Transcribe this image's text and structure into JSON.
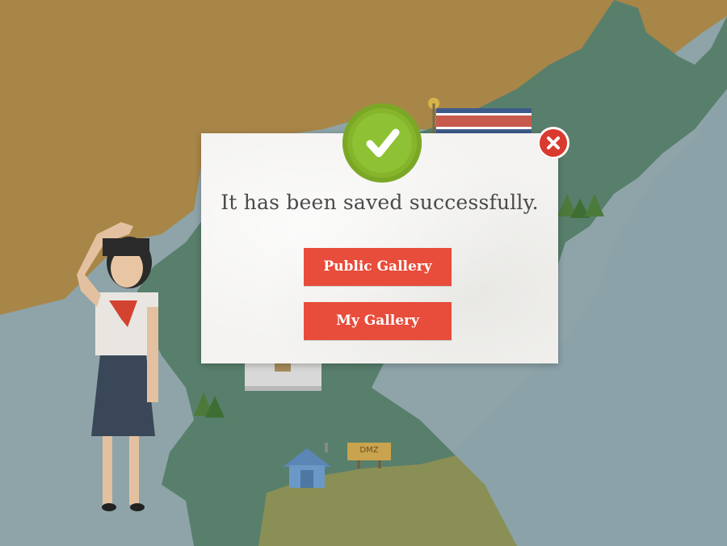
{
  "dialog": {
    "message": "It has been saved successfully.",
    "buttons": {
      "public_gallery": "Public Gallery",
      "my_gallery": "My Gallery"
    }
  },
  "map": {
    "signpost_label": "DMZ"
  },
  "icons": {
    "success": "check-icon",
    "close": "close-icon"
  },
  "colors": {
    "accent_red": "#e84c3a",
    "success_green": "#8ec234",
    "close_red": "#d93a30"
  }
}
